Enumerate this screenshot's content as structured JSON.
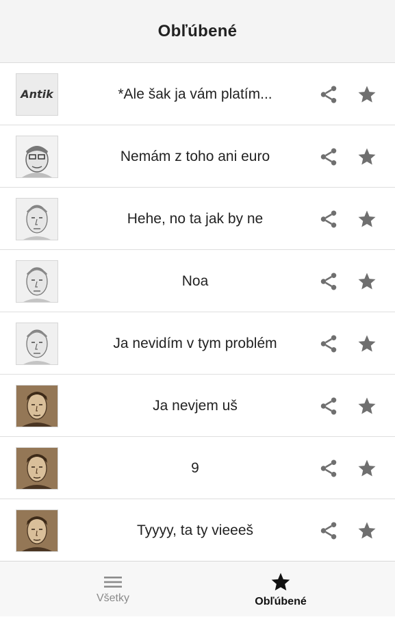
{
  "header": {
    "title": "Obľúbené"
  },
  "items": [
    {
      "text": "*Ale šak ja vám platím...",
      "avatar": "antik-logo"
    },
    {
      "text": "Nemám z toho ani euro",
      "avatar": "cartoon-face"
    },
    {
      "text": "Hehe, no ta jak by ne",
      "avatar": "sketch-face"
    },
    {
      "text": "Noa",
      "avatar": "sketch-face"
    },
    {
      "text": "Ja nevidím v tym problém",
      "avatar": "sketch-face"
    },
    {
      "text": "Ja nevjem uš",
      "avatar": "sepia-face"
    },
    {
      "text": "9",
      "avatar": "sepia-face"
    },
    {
      "text": "Tyyyy, ta ty vieeeš",
      "avatar": "sepia-face"
    }
  ],
  "thumb_texts": {
    "antik": "Antik"
  },
  "icons": {
    "share": "share-icon",
    "favorite": "star-icon",
    "menu": "menu-icon"
  },
  "colors": {
    "icon": "#6f6f6f",
    "header_bg": "#f4f4f4",
    "nav_bg": "#f7f7f7",
    "sepia": "#8a6a48"
  },
  "bottom_nav": {
    "all_label": "Všetky",
    "favorites_label": "Obľúbené",
    "active": "favorites"
  }
}
